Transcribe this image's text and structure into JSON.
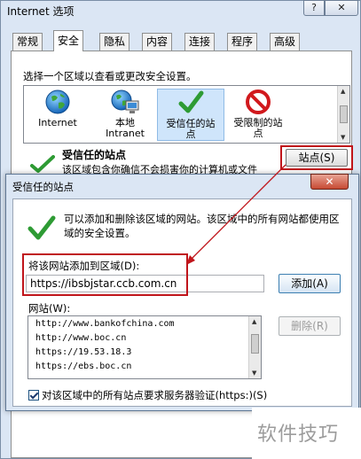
{
  "internet_options": {
    "title": "Internet 选项",
    "help_label": "?",
    "close_label": "✕",
    "tabs": [
      {
        "label": "常规"
      },
      {
        "label": "安全"
      },
      {
        "label": "隐私"
      },
      {
        "label": "内容"
      },
      {
        "label": "连接"
      },
      {
        "label": "程序"
      },
      {
        "label": "高级"
      }
    ],
    "active_tab": "安全",
    "zone_prompt": "选择一个区域以查看或更改安全设置。",
    "zones": [
      {
        "label": "Internet",
        "icon": "globe-icon"
      },
      {
        "label": "本地\nIntranet",
        "icon": "intranet-icon"
      },
      {
        "label": "受信任的站\n点",
        "icon": "check-icon"
      },
      {
        "label": "受限制的站\n点",
        "icon": "restricted-icon"
      }
    ],
    "trusted_heading": "受信任的站点",
    "trusted_desc": "该区域包含你确信不会损害你的计算机或文件",
    "sites_button": "站点(S)"
  },
  "trusted_sites": {
    "title": "受信任的站点",
    "close_label": "✕",
    "info": "可以添加和删除该区域的网站。该区域中的所有网站都使用区域的安全设置。",
    "add_label": "将该网站添加到区域(D):",
    "url_value": "https://ibsbjstar.ccb.com.cn",
    "add_button": "添加(A)",
    "sites_label": "网站(W):",
    "sites": [
      "http://www.bankofchina.com",
      "http://www.boc.cn",
      "https://19.53.18.3",
      "https://ebs.boc.cn"
    ],
    "remove_button": "删除(R)",
    "verify_label": "对该区域中的所有站点要求服务器验证(https:)(S)",
    "verify_checked": true
  },
  "watermark": "软件技巧",
  "colors": {
    "highlight": "#c0151b",
    "window_frame": "#dbe6f4"
  }
}
